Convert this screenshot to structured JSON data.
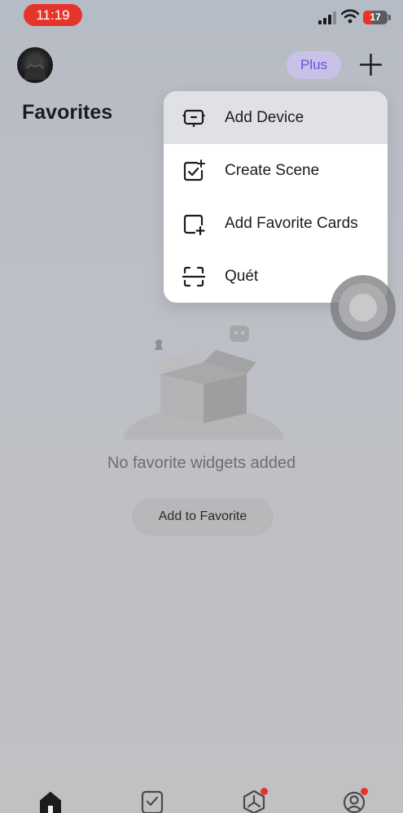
{
  "status_bar": {
    "time": "11:19",
    "battery_level": "17"
  },
  "header": {
    "plan_badge": "Plus",
    "add_icon": "plus-icon",
    "title": "Favorites"
  },
  "menu": {
    "items": [
      {
        "label": "Add Device",
        "icon": "device-icon",
        "highlighted": true
      },
      {
        "label": "Create Scene",
        "icon": "scene-check-icon",
        "highlighted": false
      },
      {
        "label": "Add Favorite Cards",
        "icon": "add-card-icon",
        "highlighted": false
      },
      {
        "label": "Quét",
        "icon": "scan-icon",
        "highlighted": false
      }
    ]
  },
  "empty_state": {
    "message": "No favorite widgets added",
    "button_label": "Add to Favorite",
    "illustration": "empty-box-illustration"
  },
  "tab_bar": {
    "tabs": [
      {
        "icon": "home-icon",
        "active": true,
        "badge": false
      },
      {
        "icon": "scene-tab-icon",
        "active": false,
        "badge": false
      },
      {
        "icon": "smart-hub-icon",
        "active": false,
        "badge": true
      },
      {
        "icon": "profile-icon",
        "active": false,
        "badge": true
      }
    ]
  },
  "colors": {
    "time_pill": "#e5352b",
    "plus_badge_bg": "#c8c3e6",
    "plus_badge_text": "#6a4fe0",
    "menu_highlight": "#dfe1e5",
    "badge_dot": "#e5352b"
  }
}
